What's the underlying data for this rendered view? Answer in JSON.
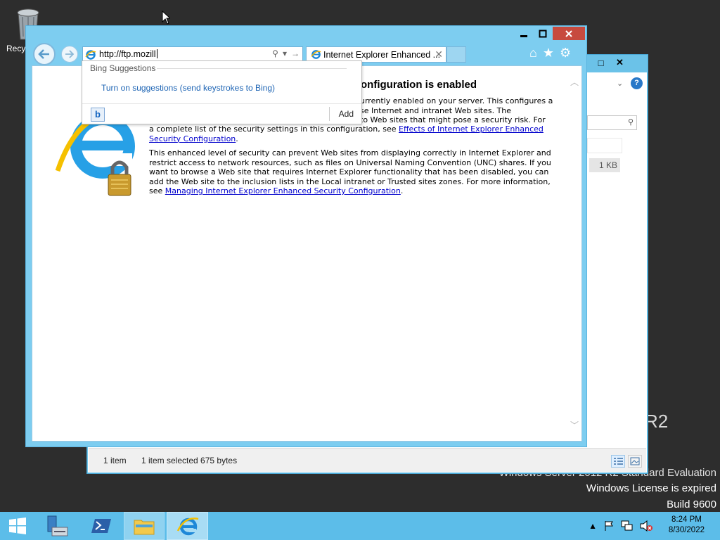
{
  "desktop": {
    "recycle_label": "Recyc",
    "watermark": {
      "line1": "Windows Server 2012 R2 Standard Evaluation",
      "line2": "Windows License is expired",
      "line3": "Build 9600",
      "r2": "R2"
    }
  },
  "explorer": {
    "size_value": "1 KB",
    "status": {
      "items": "1 item",
      "selected": "1 item selected  675 bytes"
    }
  },
  "ie": {
    "address_url": "http://ftp.mozill",
    "tab_title": "Internet Explorer Enhanced ...",
    "heading_visible": "onfiguration is enabled",
    "para1_line1": "urrently enabled on your server. This configures a",
    "para1_line2": "se Internet and intranet Web sites. The",
    "para1_line3": "to Web sites that might pose a security risk. For",
    "para1_rest": "a complete list of the security settings in this configuration, see ",
    "para1_link": "Effects of Internet Explorer Enhanced Security Configuration",
    "para2": "This enhanced level of security can prevent Web sites from displaying correctly in Internet Explorer and restrict access to network resources, such as files on Universal Naming Convention (UNC) shares. If you want to browse a Web site that requires Internet Explorer functionality that has been disabled, you can add the Web site to the inclusion lists in the Local intranet or Trusted sites zones. For more information, see ",
    "para2_link": "Managing Internet Explorer Enhanced Security Configuration",
    "suggestions": {
      "header": "Bing Suggestions",
      "link": "Turn on suggestions (send keystrokes to Bing)",
      "add": "Add"
    }
  },
  "taskbar": {
    "clock_time": "8:24 PM",
    "clock_date": "8/30/2022"
  },
  "colors": {
    "taskbar": "#5cbde9",
    "window_frame": "#7dcdf0",
    "close_button": "#c74a3e",
    "link": "#0000cc"
  }
}
